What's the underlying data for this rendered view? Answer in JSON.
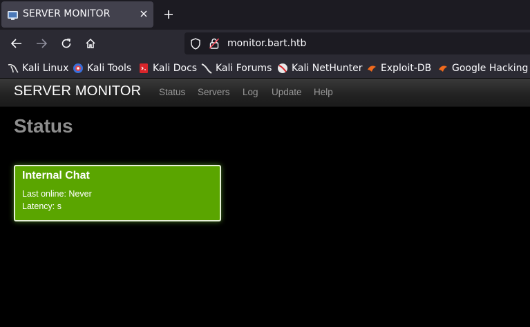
{
  "browser": {
    "tab": {
      "title": "SERVER MONITOR",
      "favicon": "monitor-favicon-icon",
      "close_icon": "close-icon"
    },
    "new_tab_icon": "plus-icon",
    "nav": {
      "back_icon": "back-arrow-icon",
      "forward_icon": "forward-arrow-icon",
      "reload_icon": "reload-icon",
      "home_icon": "home-icon"
    },
    "url": "monitor.bart.htb",
    "bookmarks": [
      {
        "label": "Kali Linux",
        "icon": "kali-dragon-icon"
      },
      {
        "label": "Kali Tools",
        "icon": "kali-tools-icon"
      },
      {
        "label": "Kali Docs",
        "icon": "kali-docs-icon"
      },
      {
        "label": "Kali Forums",
        "icon": "kali-forums-icon"
      },
      {
        "label": "Kali NetHunter",
        "icon": "nethunter-icon"
      },
      {
        "label": "Exploit-DB",
        "icon": "exploitdb-icon"
      },
      {
        "label": "Google Hacking Db",
        "icon": "ghdb-icon"
      }
    ]
  },
  "site": {
    "brand": "SERVER MONITOR",
    "nav": [
      "Status",
      "Servers",
      "Log",
      "Update",
      "Help"
    ],
    "page_title": "Status",
    "servers": [
      {
        "name": "Internal Chat",
        "last_online": "Last online: Never",
        "latency": "Latency: s",
        "status_color": "#5aa500"
      }
    ]
  },
  "colors": {
    "tab_bg": "#42414d",
    "toolbar_bg": "#2b2a33",
    "urlbar_bg": "#1c1b22",
    "page_bg": "#000000",
    "card_green": "#5aa500"
  }
}
